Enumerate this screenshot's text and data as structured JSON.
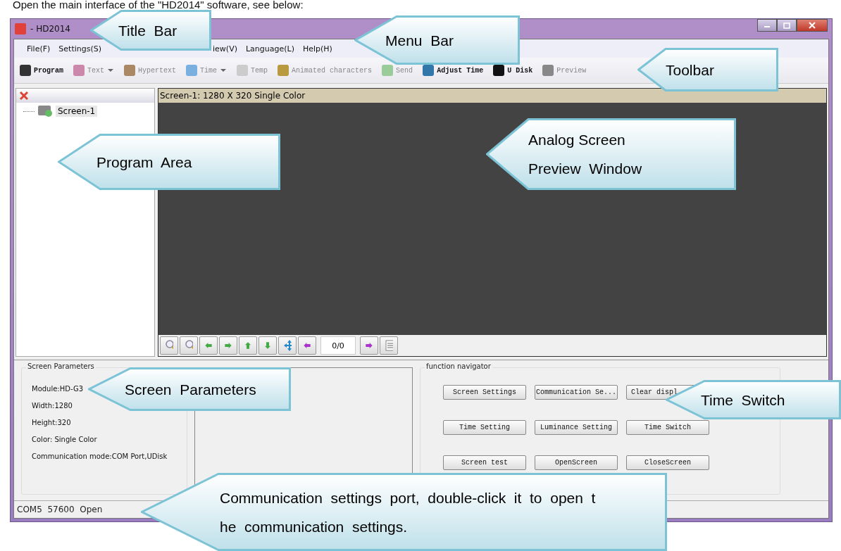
{
  "heading": "Open the main interface of the \"HD2014\" software, see below:",
  "window": {
    "title": "- HD2014"
  },
  "menu": [
    "File(F)",
    "Settings(S)",
    "iew(V)",
    "Language(L)",
    "Help(H)"
  ],
  "toolbar": [
    {
      "label": "Program",
      "disabled": false,
      "dropdown": false
    },
    {
      "label": "Text",
      "disabled": true,
      "dropdown": true
    },
    {
      "label": "Hypertext",
      "disabled": true,
      "dropdown": false
    },
    {
      "label": "Time",
      "disabled": true,
      "dropdown": true
    },
    {
      "label": "Temp",
      "disabled": true,
      "dropdown": false
    },
    {
      "label": "Animated characters",
      "disabled": true,
      "dropdown": false
    },
    {
      "label": "Send",
      "disabled": true,
      "dropdown": false
    },
    {
      "label": "Adjust Time",
      "disabled": false,
      "dropdown": false
    },
    {
      "label": "U Disk",
      "disabled": false,
      "dropdown": false
    },
    {
      "label": "Preview",
      "disabled": true,
      "dropdown": false
    }
  ],
  "tree": [
    {
      "label": "Screen-1",
      "selected": true
    }
  ],
  "preview": {
    "header": "Screen-1: 1280 X 320 Single Color",
    "page_field": "0/0"
  },
  "screen_parameters": {
    "title": "Screen Parameters",
    "lines": [
      "Module:HD-G3",
      "Width:1280",
      "Height:320",
      "Color: Single Color",
      "Communication mode:COM Port,UDisk"
    ]
  },
  "function_navigator": {
    "title": "function navigator",
    "buttons": [
      "Screen Settings",
      "Communication Se...",
      "Clear displ",
      "Time Setting",
      "Luminance Setting",
      "Time Switch",
      "Screen test",
      "OpenScreen",
      "CloseScreen"
    ]
  },
  "status_bar": "COM5  57600  Open",
  "callouts": [
    {
      "lines": [
        "Title  Bar"
      ]
    },
    {
      "lines": [
        "Menu  Bar"
      ]
    },
    {
      "lines": [
        "Toolbar"
      ]
    },
    {
      "lines": [
        "Program  Area"
      ]
    },
    {
      "lines": [
        "Analog Screen",
        "Preview  Window"
      ]
    },
    {
      "lines": [
        "Screen  Parameters"
      ]
    },
    {
      "lines": [
        "Time  Switch"
      ]
    },
    {
      "lines": [
        "Communication  settings  port,  double-click  it  to  open  t",
        "he  communication  settings."
      ]
    }
  ]
}
